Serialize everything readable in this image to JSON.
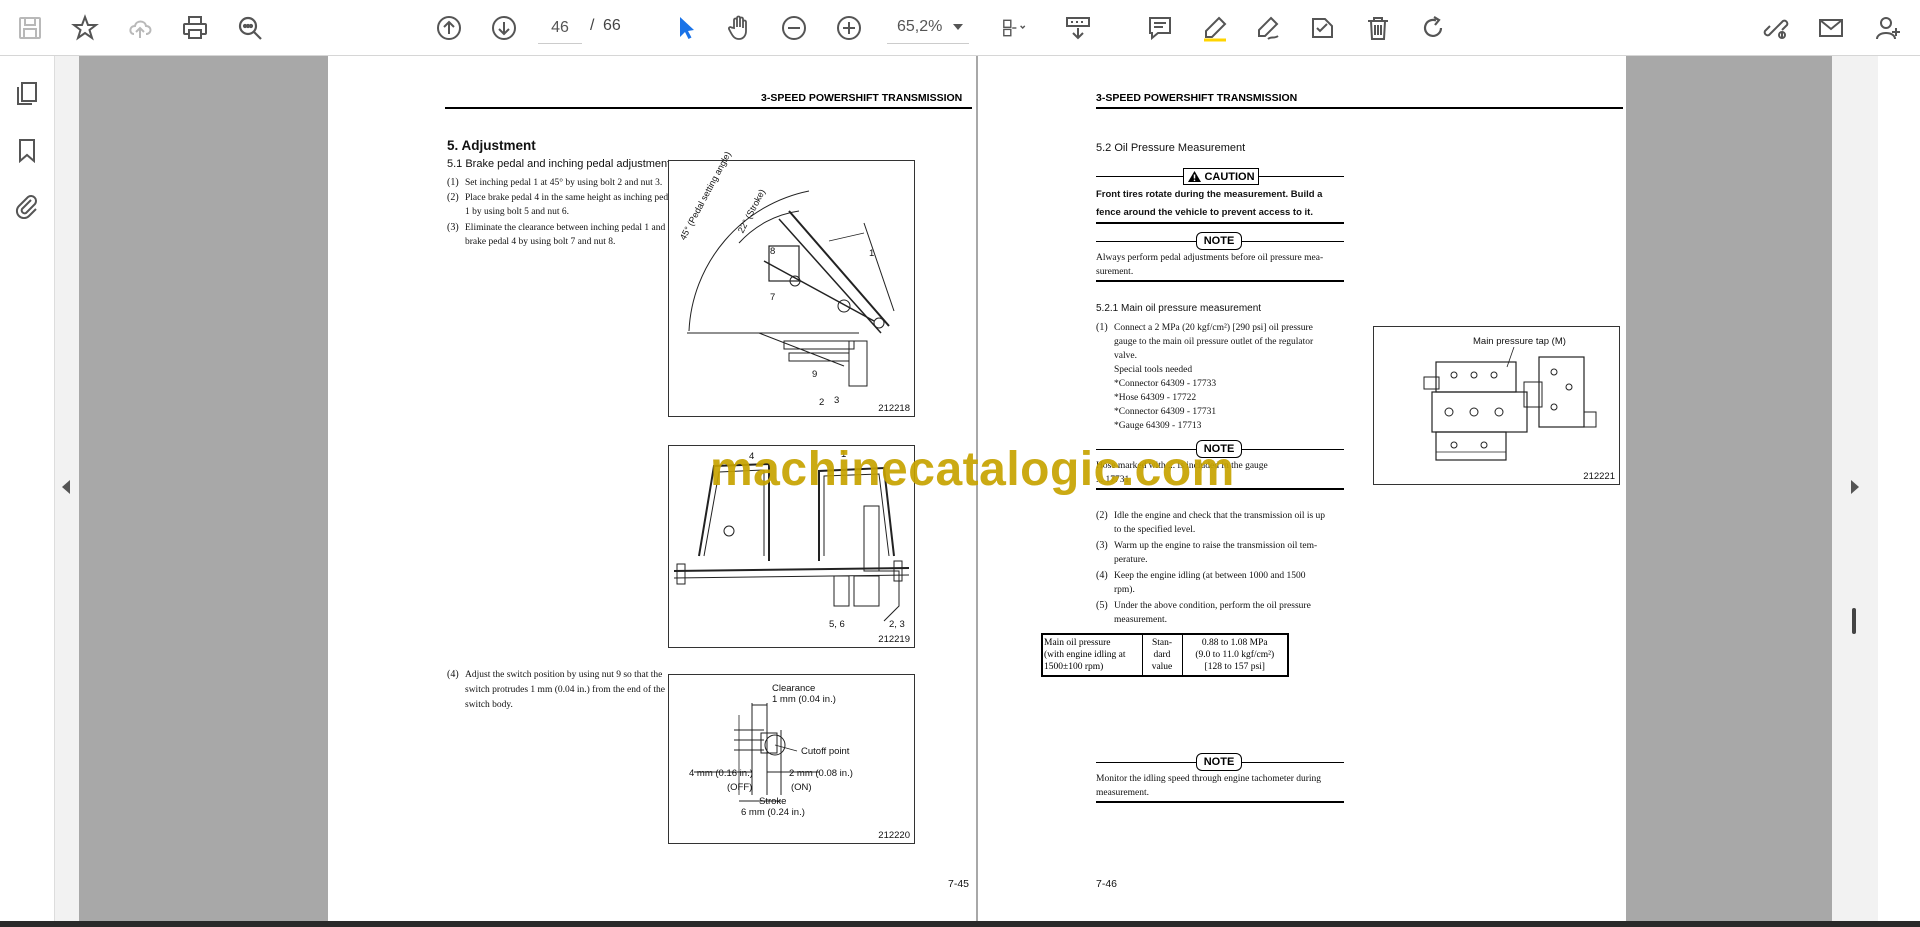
{
  "toolbar": {
    "page_current": "46",
    "page_separator": "/",
    "page_total": "66",
    "zoom": "65,2%"
  },
  "colors": {
    "viewer_bg": "#a8a8a8",
    "accent_blue": "#1a73e8",
    "watermark": "#c7a300"
  },
  "watermark": "machinecatalogic.com",
  "left_page": {
    "header": "3-SPEED POWERSHIFT TRANSMISSION",
    "section_title": "5. Adjustment",
    "subsection": "5.1   Brake pedal and inching pedal adjustment",
    "steps": [
      {
        "n": "(1)",
        "lines": [
          "Set inching pedal 1 at 45° by using bolt 2 and nut 3."
        ]
      },
      {
        "n": "(2)",
        "lines": [
          "Place brake pedal 4 in the same height as inching pedal",
          "1 by using bolt 5 and nut 6."
        ]
      },
      {
        "n": "(3)",
        "lines": [
          "Eliminate the clearance between inching pedal 1 and",
          "brake pedal 4 by using bolt 7 and nut 8."
        ]
      }
    ],
    "step4": {
      "n": "(4)",
      "lines": [
        "Adjust the switch position by using nut 9 so that the",
        "switch protrudes 1 mm (0.04 in.) from the end of the",
        "switch body."
      ]
    },
    "fig1": {
      "code": "212218",
      "angle_label": "45° (Pedal setting angle)",
      "stroke_label": "22° (Stroke)",
      "callouts": [
        "1",
        "8",
        "7",
        "9",
        "2",
        "3"
      ]
    },
    "fig2": {
      "code": "212219",
      "callouts": [
        "4",
        "1",
        "5, 6",
        "2, 3"
      ]
    },
    "fig3": {
      "code": "212220",
      "clearance": "Clearance",
      "clearance_val": "1 mm (0.04 in.)",
      "cutoff": "Cutoff point",
      "off_val": "4 mm (0.16 in.)",
      "off": "(OFF)",
      "on_val": "2 mm (0.08 in.)",
      "on": "(ON)",
      "stroke": "Stroke",
      "stroke_val": "6 mm (0.24 in.)"
    },
    "page_number": "7-45"
  },
  "right_page": {
    "header": "3-SPEED POWERSHIFT TRANSMISSION",
    "subsection": "5.2   Oil Pressure Measurement",
    "caution_label": "CAUTION",
    "caution_text": [
      "Front tires rotate during the measurement. Build a",
      "fence around the vehicle to prevent access to it."
    ],
    "note_label": "NOTE",
    "note1_text": [
      "Always perform pedal adjustments before oil pressure mea-",
      "surement."
    ],
    "sub_sub": "5.2.1   Main oil pressure measurement",
    "step1": {
      "n": "(1)",
      "lines": [
        "Connect a 2 MPa (20 kgf/cm²) [290 psi] oil pressure",
        "gauge to the main oil pressure outlet of the regulator",
        "valve.",
        "Special tools needed",
        "*Connector 64309 - 17733",
        "*Hose 64309 - 17722",
        "*Connector 64309 - 17731",
        "*Gauge 64309 - 17713"
      ]
    },
    "note2_text": [
      "Hose marked with ... is included in the gauge",
      "... 17731"
    ],
    "steps": [
      {
        "n": "(2)",
        "lines": [
          "Idle the engine and check that the transmission oil is up",
          "to the specified level."
        ]
      },
      {
        "n": "(3)",
        "lines": [
          "Warm up the engine to raise the transmission oil tem-",
          "perature."
        ]
      },
      {
        "n": "(4)",
        "lines": [
          "Keep the engine idling (at between 1000 and 1500",
          "rpm)."
        ]
      },
      {
        "n": "(5)",
        "lines": [
          "Under the above condition, perform the oil pressure",
          "measurement."
        ]
      }
    ],
    "spec_table": {
      "col1": [
        "Main oil pressure",
        "(with engine idling at",
        "1500±100 rpm)"
      ],
      "col2": [
        "Stan-",
        "dard",
        "value"
      ],
      "col3": [
        "0.88 to 1.08 MPa",
        "(9.0 to 11.0 kgf/cm²)",
        "[128 to 157 psi]"
      ]
    },
    "note3_text": [
      "Monitor the idling speed through engine tachometer during",
      "measurement."
    ],
    "fig": {
      "code": "212221",
      "label": "Main pressure tap (M)"
    },
    "page_number": "7-46"
  }
}
